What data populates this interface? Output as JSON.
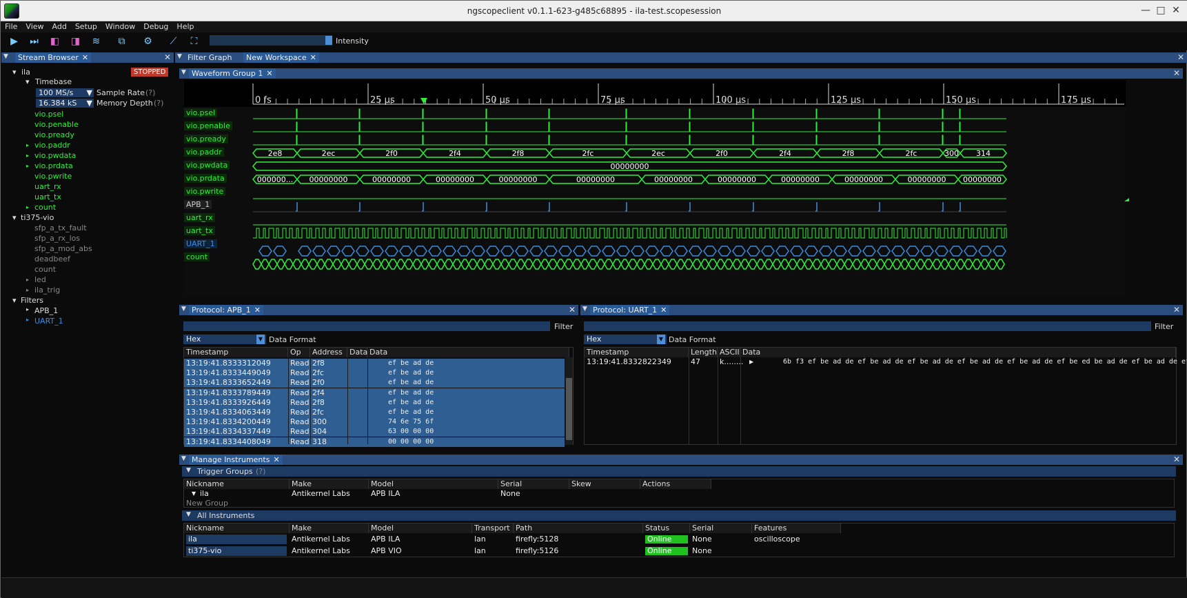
{
  "window": {
    "title": "ngscopeclient v0.1.1-623-g485c68895  - ila-test.scopesession"
  },
  "menu": [
    "File",
    "View",
    "Add",
    "Setup",
    "Window",
    "Debug",
    "Help"
  ],
  "toolbar": {
    "intensity_label": "Intensity"
  },
  "stream_browser": {
    "tab_label": "Stream Browser",
    "ila": {
      "name": "ila",
      "status": "STOPPED",
      "timebase": "Timebase",
      "sample_rate_value": "100 MS/s",
      "sample_rate_label": "Sample Rate",
      "memory_depth_value": "16.384 kS",
      "memory_depth_label": "Memory Depth",
      "help": "(?)",
      "streams": [
        "vio.psel",
        "vio.penable",
        "vio.pready",
        "vio.paddr",
        "vio.pwdata",
        "vio.prdata",
        "vio.pwrite",
        "uart_rx",
        "uart_tx",
        "count"
      ]
    },
    "ti375": {
      "name": "ti375-vio",
      "streams": [
        "sfp_a_tx_fault",
        "sfp_a_rx_los",
        "sfp_a_mod_abs",
        "deadbeef",
        "count",
        "led",
        "ila_trig"
      ]
    },
    "filters": {
      "name": "Filters",
      "items": [
        "APB_1",
        "UART_1"
      ]
    }
  },
  "tabs": {
    "filter_graph": "Filter Graph",
    "new_workspace": "New Workspace",
    "waveform_group": "Waveform Group 1"
  },
  "waveform": {
    "time_labels": [
      "0 fs",
      "25 µs",
      "50 µs",
      "75 µs",
      "100 µs",
      "125 µs",
      "150 µs",
      "175 µs"
    ],
    "channels": [
      "vio.psel",
      "vio.penable",
      "vio.pready",
      "vio.paddr",
      "vio.pwdata",
      "vio.prdata",
      "vio.pwrite",
      "APB_1",
      "uart_rx",
      "uart_tx",
      "UART_1",
      "count"
    ],
    "paddr_values": [
      "2e8",
      "2ec",
      "2f0",
      "2f4",
      "2f8",
      "2fc",
      "2ec",
      "2f0",
      "2f4",
      "2f8",
      "2fc",
      "300",
      "314"
    ],
    "pwdata_value": "00000000",
    "prdata_values": [
      "000000...",
      "00000000",
      "00000000",
      "00000000",
      "00000000",
      "00000000",
      "00000000",
      "00000000",
      "00000000",
      "00000000",
      "00000000",
      "00000000"
    ]
  },
  "apb_protocol": {
    "tab_label": "Protocol: APB_1",
    "filter_label": "Filter",
    "format_value": "Hex",
    "format_label": "Data Format",
    "columns": [
      "Timestamp",
      "Op",
      "Address",
      "Data",
      "Data"
    ],
    "rows": [
      {
        "ts": "13:19:41.8333312049",
        "op": "Read",
        "addr": "2f8",
        "data": "ef be ad de"
      },
      {
        "ts": "13:19:41.8333449049",
        "op": "Read",
        "addr": "2fc",
        "data": "ef be ad de"
      },
      {
        "ts": "13:19:41.8333652449",
        "op": "Read",
        "addr": "2f0",
        "data": "ef be ad de"
      },
      {
        "ts": "13:19:41.8333789449",
        "op": "Read",
        "addr": "2f4",
        "data": "ef be ad de"
      },
      {
        "ts": "13:19:41.8333926449",
        "op": "Read",
        "addr": "2f8",
        "data": "ef be ad de"
      },
      {
        "ts": "13:19:41.8334063449",
        "op": "Read",
        "addr": "2fc",
        "data": "ef be ad de"
      },
      {
        "ts": "13:19:41.8334200449",
        "op": "Read",
        "addr": "300",
        "data": "74 6e 75 6f"
      },
      {
        "ts": "13:19:41.8334337449",
        "op": "Read",
        "addr": "304",
        "data": "63 00 00 00"
      },
      {
        "ts": "13:19:41.8334408049",
        "op": "Read",
        "addr": "318",
        "data": "00 00 00 00"
      }
    ]
  },
  "uart_protocol": {
    "tab_label": "Protocol: UART_1",
    "filter_label": "Filter",
    "format_value": "Hex",
    "format_label": "Data Format",
    "columns": [
      "Timestamp",
      "Length",
      "ASCII",
      "Data"
    ],
    "rows": [
      {
        "ts": "13:19:41.8332822349",
        "len": "47",
        "ascii": "k........",
        "data": "6b f3 ef be ad de ef be ad de ef be ad de ef be ad de ef be ad de ef be ed be ad de ef be ad de ef be ad"
      }
    ]
  },
  "manage": {
    "tab_label": "Manage Instruments",
    "trigger_groups": {
      "title": "Trigger Groups",
      "help": "(?)",
      "columns": [
        "Nickname",
        "Make",
        "Model",
        "Serial",
        "Skew",
        "Actions"
      ],
      "row": {
        "nickname": "ila",
        "make": "Antikernel Labs",
        "model": "APB ILA",
        "serial": "None"
      },
      "new_group": "New Group"
    },
    "all_instruments": {
      "title": "All Instruments",
      "columns": [
        "Nickname",
        "Make",
        "Model",
        "Transport",
        "Path",
        "Status",
        "Serial",
        "Features"
      ],
      "rows": [
        {
          "nickname": "ila",
          "make": "Antikernel Labs",
          "model": "APB ILA",
          "transport": "lan",
          "path": "firefly:5128",
          "status": "Online",
          "serial": "None",
          "features": "oscilloscope"
        },
        {
          "nickname": "ti375-vio",
          "make": "Antikernel Labs",
          "model": "APB VIO",
          "transport": "lan",
          "path": "firefly:5126",
          "status": "Online",
          "serial": "None",
          "features": ""
        }
      ]
    }
  },
  "colors": {
    "signal_green": "#2ef03a",
    "decode_blue": "#3b8de0",
    "tab_blue": "#2a5a96",
    "stopped_red": "#c0392b",
    "online_green": "#21c021"
  }
}
